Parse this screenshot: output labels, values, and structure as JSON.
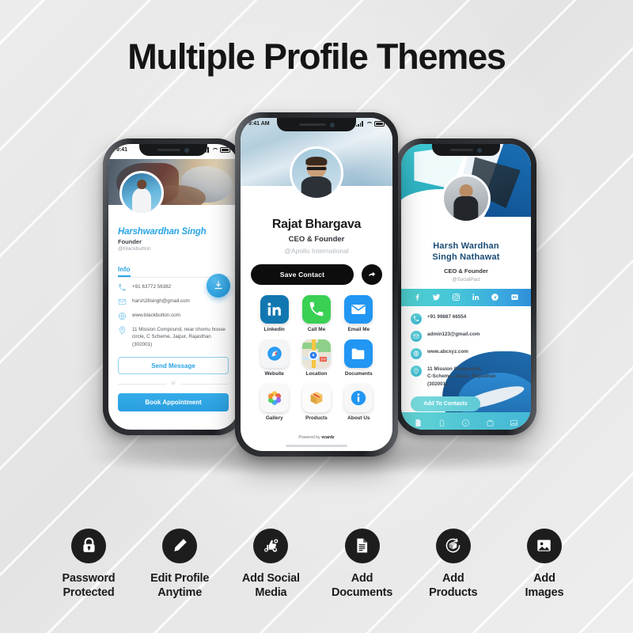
{
  "page": {
    "title": "Multiple Profile Themes",
    "background_color": "#e9e9e9",
    "accent_blue": "#2aa4e5",
    "accent_teal": "#4ec3d4",
    "dark": "#1d1d1d"
  },
  "phone_left": {
    "status_time": "9:41",
    "name": "Harshwardhan Singh",
    "role": "Founder",
    "handle": "@blackbutton",
    "tab_label": "Info",
    "download_icon": "download-icon",
    "info": [
      {
        "icon": "phone-icon",
        "text": "+91 63772 56382"
      },
      {
        "icon": "email-icon",
        "text": "harsh28singh@gmail.com"
      },
      {
        "icon": "globe-icon",
        "text": "www.blackbutton.com"
      },
      {
        "icon": "location-icon",
        "text": "11 Mission Compound, near chomu house circle, C Scheme, Jaipur, Rajasthan (302001)"
      }
    ],
    "send_message_label": "Send Message",
    "or_label": "or",
    "book_appointment_label": "Book Appointment"
  },
  "phone_center": {
    "status_time": "9:41 AM",
    "name": "Rajat Bhargava",
    "role": "CEO & Founder",
    "handle": "@Apollo International",
    "save_contact_label": "Save Contact",
    "share_icon": "share-arrow-icon",
    "grid": [
      {
        "icon": "linkedin-icon",
        "label": "Linkedin"
      },
      {
        "icon": "phone-icon",
        "label": "Call Me"
      },
      {
        "icon": "envelope-icon",
        "label": "Email Me"
      },
      {
        "icon": "safari-compass-icon",
        "label": "Website"
      },
      {
        "icon": "maps-pin-icon",
        "label": "Location"
      },
      {
        "icon": "folder-icon",
        "label": "Documents"
      },
      {
        "icon": "photos-flower-icon",
        "label": "Gallery"
      },
      {
        "icon": "box-icon",
        "label": "Products"
      },
      {
        "icon": "info-circle-icon",
        "label": "About Us"
      }
    ],
    "powered_prefix": "Powered by ",
    "powered_brand": "vcardz"
  },
  "phone_right": {
    "name": "Harsh Wardhan\nSingh Nathawat",
    "role": "CEO & Founder",
    "handle": "@SocialPact",
    "social": [
      "facebook-icon",
      "twitter-icon",
      "instagram-icon",
      "linkedin-icon",
      "telegram-icon",
      "behance-icon"
    ],
    "info": [
      {
        "icon": "phone-icon",
        "text": "+91 99887 66554"
      },
      {
        "icon": "email-icon",
        "text": "admin123@gmail.com"
      },
      {
        "icon": "globe-icon",
        "text": "www.abcxyz.com"
      },
      {
        "icon": "location-icon",
        "text": "11 Mission Compound,\nC-Scheme, Jaipur, Rajasthan\n(302001)"
      }
    ],
    "add_contacts_label": "Add To Contacts",
    "nav": [
      "document-icon",
      "tag-icon",
      "info-icon",
      "bag-icon",
      "image-icon"
    ]
  },
  "features": [
    {
      "icon": "lock-icon",
      "label": "Password\nProtected"
    },
    {
      "icon": "pencil-icon",
      "label": "Edit Profile\nAnytime"
    },
    {
      "icon": "social-icon",
      "label": "Add Social\nMedia"
    },
    {
      "icon": "document-icon",
      "label": "Add\nDocuments"
    },
    {
      "icon": "package-icon",
      "label": "Add\nProducts"
    },
    {
      "icon": "image-icon",
      "label": "Add\nImages"
    }
  ]
}
